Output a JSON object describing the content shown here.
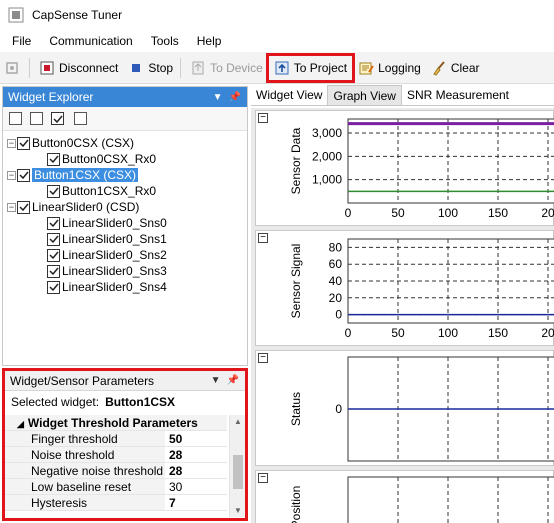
{
  "window": {
    "title": "CapSense Tuner"
  },
  "menu": [
    "File",
    "Communication",
    "Tools",
    "Help"
  ],
  "toolbar": {
    "disconnect": "Disconnect",
    "stop": "Stop",
    "to_device": "To Device",
    "to_project": "To Project",
    "logging": "Logging",
    "clear": "Clear"
  },
  "widget_explorer": {
    "title": "Widget Explorer",
    "items": [
      {
        "label": "Button0CSX (CSX)",
        "level": 0
      },
      {
        "label": "Button0CSX_Rx0",
        "level": 1
      },
      {
        "label": "Button1CSX (CSX)",
        "level": 0,
        "selected": true
      },
      {
        "label": "Button1CSX_Rx0",
        "level": 1
      },
      {
        "label": "LinearSlider0 (CSD)",
        "level": 0
      },
      {
        "label": "LinearSlider0_Sns0",
        "level": 1
      },
      {
        "label": "LinearSlider0_Sns1",
        "level": 1
      },
      {
        "label": "LinearSlider0_Sns2",
        "level": 1
      },
      {
        "label": "LinearSlider0_Sns3",
        "level": 1
      },
      {
        "label": "LinearSlider0_Sns4",
        "level": 1
      }
    ]
  },
  "params": {
    "title": "Widget/Sensor Parameters",
    "selected_label": "Selected widget:",
    "selected_value": "Button1CSX",
    "category": "Widget Threshold Parameters",
    "rows": [
      {
        "name": "Finger threshold",
        "value": "50",
        "bold": true
      },
      {
        "name": "Noise threshold",
        "value": "28",
        "bold": true
      },
      {
        "name": "Negative noise threshold",
        "value": "28",
        "bold": true
      },
      {
        "name": "Low baseline reset",
        "value": "30",
        "bold": false
      },
      {
        "name": "Hysteresis",
        "value": "7",
        "bold": true
      }
    ]
  },
  "tabs": [
    "Widget View",
    "Graph View",
    "SNR Measurement"
  ],
  "active_tab": "Graph View",
  "chart_data": [
    {
      "type": "line",
      "ylabel": "Sensor Data",
      "y_ticks": [
        "3,000",
        "2,000",
        "1,000"
      ],
      "x_ticks": [
        "0",
        "50",
        "100",
        "150",
        "20"
      ],
      "series": [
        {
          "color": "#7a1fa2",
          "values": [
            3400,
            3400,
            3400,
            3400,
            3400
          ]
        },
        {
          "color": "#2e8b2e",
          "values": [
            500,
            500,
            500,
            500,
            500
          ]
        }
      ]
    },
    {
      "type": "line",
      "ylabel": "Sensor Signal",
      "y_ticks": [
        "80",
        "60",
        "40",
        "20",
        "0"
      ],
      "x_ticks": [
        "0",
        "50",
        "100",
        "150",
        "20"
      ],
      "series": [
        {
          "color": "#1a2a9a",
          "values": [
            0,
            0,
            0,
            0,
            0
          ]
        }
      ]
    },
    {
      "type": "line",
      "ylabel": "Status",
      "y_ticks": [
        "0"
      ],
      "x_ticks": [],
      "series": [
        {
          "color": "#1a2a9a",
          "values": [
            0,
            0,
            0,
            0,
            0
          ]
        }
      ]
    },
    {
      "type": "line",
      "ylabel": "Position",
      "y_ticks": [],
      "x_ticks": [],
      "series": []
    }
  ],
  "colors": {
    "highlight": "#e0141b",
    "selection": "#3d8ee0",
    "panel_header": "#3a86d6"
  }
}
